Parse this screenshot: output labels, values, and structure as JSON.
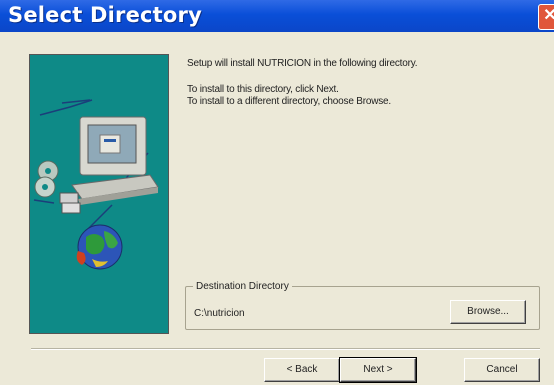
{
  "window": {
    "title": "Select Directory"
  },
  "content": {
    "line1": "Setup will install NUTRICION in the following directory.",
    "line2": "To install to this directory, click Next.",
    "line3": "To install to a different directory, choose Browse."
  },
  "destination": {
    "legend": "Destination Directory",
    "path": "C:\\nutricion",
    "browse_label": "Browse..."
  },
  "buttons": {
    "back_label": "< Back",
    "next_label": "Next >",
    "cancel_label": "Cancel"
  },
  "icons": {
    "close": "close-icon",
    "wizard": "computer-setup-illustration"
  },
  "colors": {
    "titlebar": "#0a4fd8",
    "side_panel": "#0e8a87",
    "close_button": "#e0563a"
  }
}
